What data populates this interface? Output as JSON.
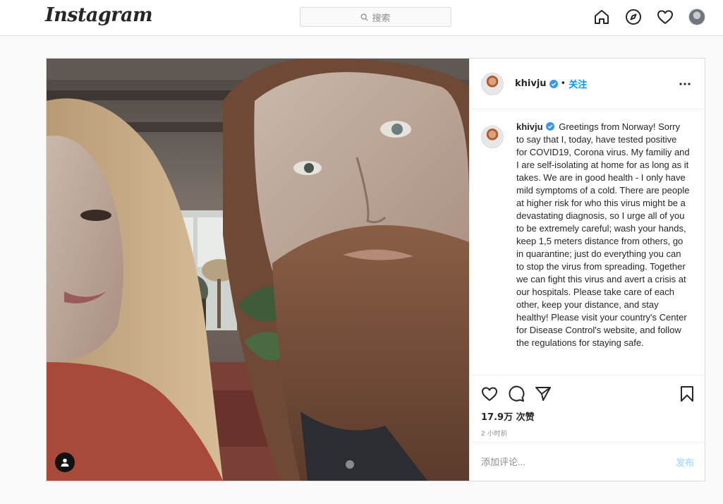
{
  "app": {
    "logo_text": "Instagram",
    "search_placeholder": "搜索"
  },
  "nav": {
    "icons": [
      "home-icon",
      "explore-icon",
      "activity-heart-icon",
      "profile-avatar"
    ]
  },
  "post": {
    "author": "khivju",
    "verified": true,
    "separator": "•",
    "follow_label": "关注",
    "caption": "Greetings from Norway! Sorry to say that I, today, have tested positive for COVID19, Corona virus. My familiy and I are self-isolating at home for as long as it takes. We are in good health - I only have mild symptoms of a cold. There are people at higher risk for who this virus might be a devastating diagnosis, so I urge all of you to be extremely careful; wash your hands, keep 1,5 meters distance from others, go in quarantine; just do everything you can to stop the virus from spreading. Together we can fight this virus and avert a crisis at our hospitals. Please take care of each other, keep your distance, and stay healthy! Please visit your country's Center for Disease Control's website, and follow the regulations for staying safe.",
    "likes": "17.9万 次赞",
    "time_ago": "2 小时前",
    "comment_placeholder": "添加评论...",
    "post_button_label": "发布"
  },
  "colors": {
    "accent": "#0095f6",
    "post_button_disabled": "#b2dffc",
    "border": "#dbdbdb",
    "background": "#fafafa"
  }
}
